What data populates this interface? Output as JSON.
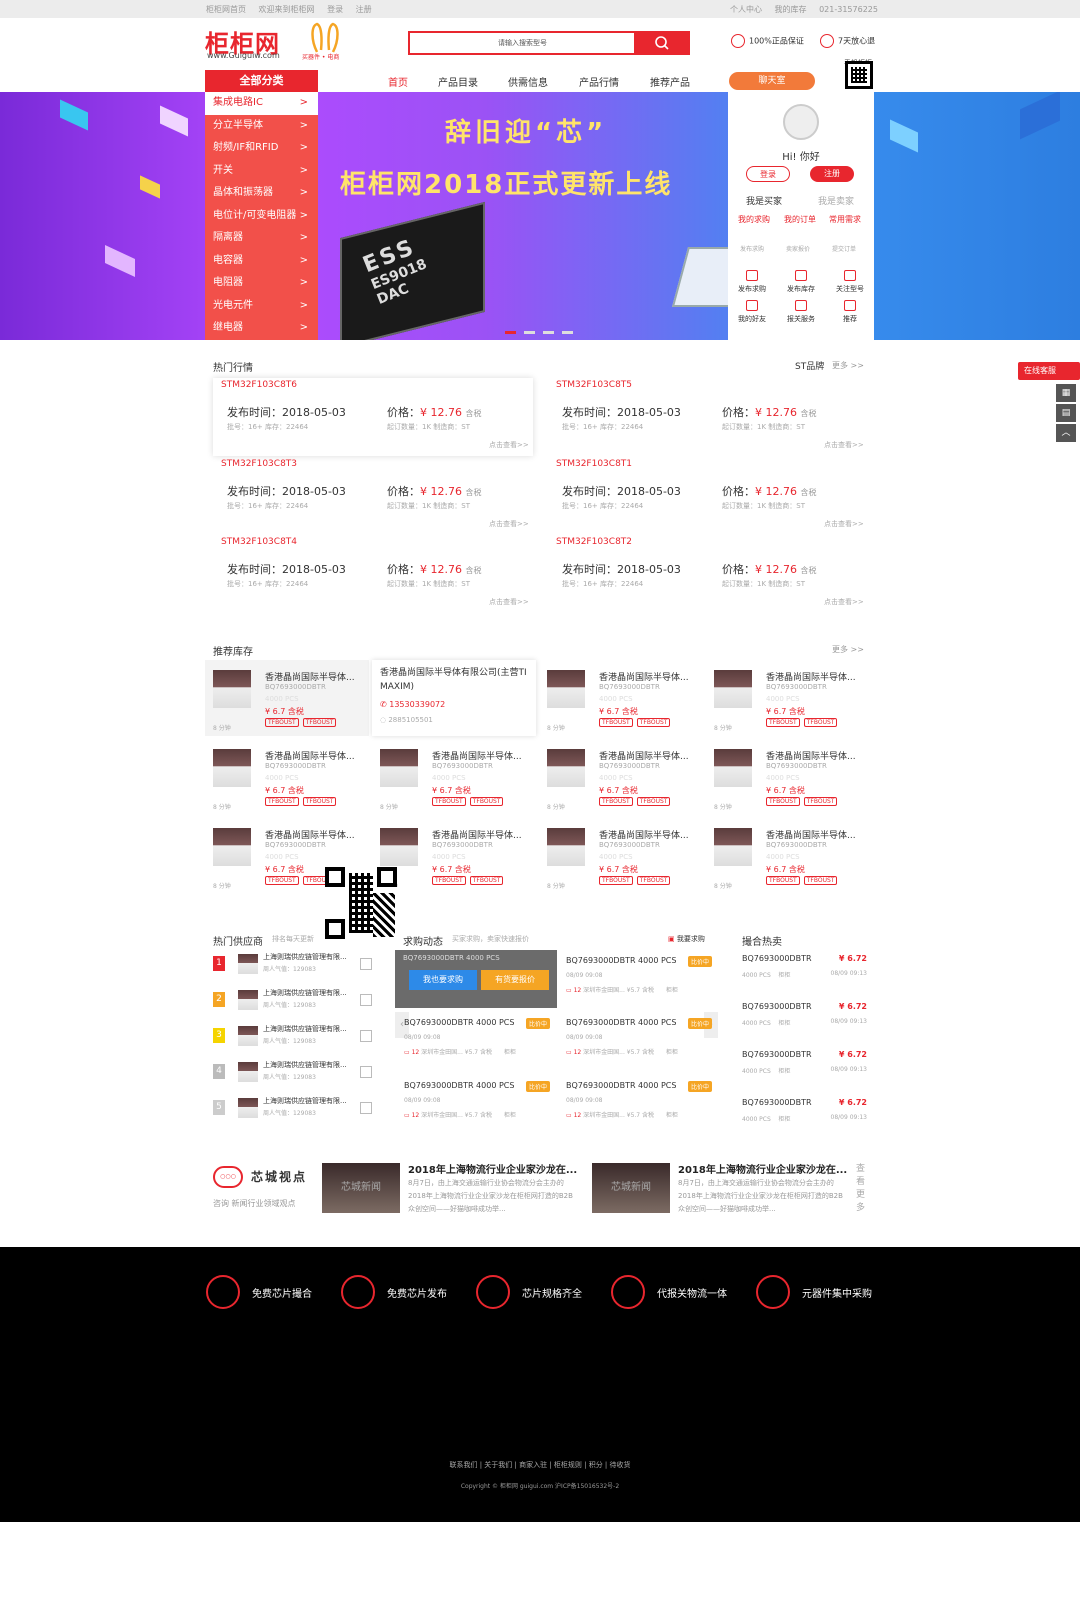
{
  "topbar": {
    "home": "柜柜网首页",
    "welcome": "欢迎来到柜柜网",
    "login": "登录",
    "register": "注册",
    "personal": "个人中心",
    "my_stock": "我的库存",
    "phone": "021-31576225"
  },
  "header": {
    "logo": "柜柜网",
    "logo_url": "www.Guiguiw.com",
    "slogan": "买器件 • 电商",
    "search_placeholder": "请输入搜索型号",
    "guarantee1": "100%正品保证",
    "guarantee2": "7天放心退",
    "qr_label": "手机柜柜"
  },
  "nav": {
    "all_categories": "全部分类",
    "items": [
      "首页",
      "产品目录",
      "供需信息",
      "产品行情",
      "推荐产品"
    ],
    "chat": "聊天室"
  },
  "categories": [
    "集成电路IC",
    "分立半导体",
    "射频/IF和RFID",
    "开关",
    "晶体和振荡器",
    "电位计/可变电阻器",
    "隔离器",
    "电容器",
    "电阻器",
    "光电元件",
    "继电器"
  ],
  "banner": {
    "title1": "辞旧迎“芯”",
    "title2": "柜柜网2018正式更新上线",
    "chip_brand": "ESS",
    "chip_model": "ES9018",
    "chip_type": "DAC"
  },
  "user_panel": {
    "greeting": "Hi! 你好",
    "login": "登录",
    "register": "注册",
    "tab_buyer": "我是买家",
    "tab_seller": "我是卖家",
    "links": [
      "我的求购",
      "我的订单",
      "常用需求"
    ],
    "faded": [
      "发布求购",
      "卖家报价",
      "提交订单"
    ],
    "grid": [
      "发布求购",
      "发布库存",
      "关注型号",
      "我的好友",
      "报关服务",
      "推荐"
    ]
  },
  "float": {
    "online": "在线客服"
  },
  "hot_market": {
    "title": "热门行情",
    "brand": "ST品牌",
    "more": "更多 >>",
    "date_label": "发布时间：",
    "price_label": "价格：",
    "tax": "含税",
    "view": "点击查看>>",
    "items": [
      {
        "name": "STM32F103C8T6",
        "date": "2018-05-03",
        "price": "¥ 12.76",
        "lot": "批号：16+   库存：22464",
        "moq": "起订数量：1K   制造商：ST"
      },
      {
        "name": "STM32F103C8T5",
        "date": "2018-05-03",
        "price": "¥ 12.76",
        "lot": "批号：16+   库存：22464",
        "moq": "起订数量：1K   制造商：ST"
      },
      {
        "name": "STM32F103C8T3",
        "date": "2018-05-03",
        "price": "¥ 12.76",
        "lot": "批号：16+   库存：22464",
        "moq": "起订数量：1K   制造商：ST"
      },
      {
        "name": "STM32F103C8T1",
        "date": "2018-05-03",
        "price": "¥ 12.76",
        "lot": "批号：16+   库存：22464",
        "moq": "起订数量：1K   制造商：ST"
      },
      {
        "name": "STM32F103C8T4",
        "date": "2018-05-03",
        "price": "¥ 12.76",
        "lot": "批号：16+   库存：22464",
        "moq": "起订数量：1K   制造商：ST"
      },
      {
        "name": "STM32F103C8T2",
        "date": "2018-05-03",
        "price": "¥ 12.76",
        "lot": "批号：16+   库存：22464",
        "moq": "起订数量：1K   制造商：ST"
      }
    ]
  },
  "stock": {
    "title": "推荐库存",
    "more": "更多 >>",
    "item": {
      "title": "香港晶尚国际半导体...",
      "model": "BQ7693000DBTR",
      "qty": "4000 PCS",
      "price": "¥ 6.7 含税",
      "tag": "TFBOUST",
      "time": "8 分钟"
    },
    "popup": {
      "company": "香港晶尚国际半导体有限公司(主营TI MAXIM)",
      "phone": "13530339072",
      "qq": "2885105501"
    }
  },
  "suppliers": {
    "title": "热门供应商",
    "subtitle": "排名每天更新",
    "name": "上海则瑞供应链管理有限...",
    "popularity": "周人气值：129083",
    "ranks": [
      "1",
      "2",
      "3",
      "4",
      "5"
    ]
  },
  "demand": {
    "title": "求购动态",
    "subtitle": "买家求购，卖家快速报价",
    "my_request": "我要求购",
    "btn_request": "我也要求购",
    "btn_quote": "有货要报价",
    "item_title": "BQ7693000DBTR    4000 PCS",
    "badge": "比价中",
    "date": "08/09  09:08",
    "footer_count": "12",
    "footer_text": "深圳市金田国...  ¥5.7 含税",
    "footer_brand": "柜柜"
  },
  "hot_deals": {
    "title": "撮合热卖",
    "model": "BQ7693000DBTR",
    "price": "¥ 6.72",
    "qty": "4000 PCS",
    "brand": "柜柜",
    "date": "08/09  09:13"
  },
  "viewpoint": {
    "title": "芯城视点",
    "subtitle": "咨询  新闻行业领域观点",
    "more": "查看更多",
    "image_text": "芯城新闻",
    "news_title": "2018年上海物流行业企业家沙龙在...",
    "news_desc": "8月7日，由上海交通运输行业协会物流分会主办的2018年上海物流行业企业家沙龙在柜柜网打造的B2B众创空间——好猫咖啡成功举..."
  },
  "footer": {
    "features": [
      "免费芯片撮合",
      "免费芯片发布",
      "芯片规格齐全",
      "代报关物流一体",
      "元器件集中采购"
    ],
    "links": "联系我们  |  关于我们  |  商家入驻  |  柜柜规则  |  积分  |  待收货",
    "copyright": "Copyright  ©  柜柜网 guigui.com 沪ICP备15016532号-2"
  },
  "colors": {
    "brand": "#e8262e",
    "menu_bg": "#f2504a",
    "badge": "#f5a524",
    "footer_bg": "#000000"
  }
}
